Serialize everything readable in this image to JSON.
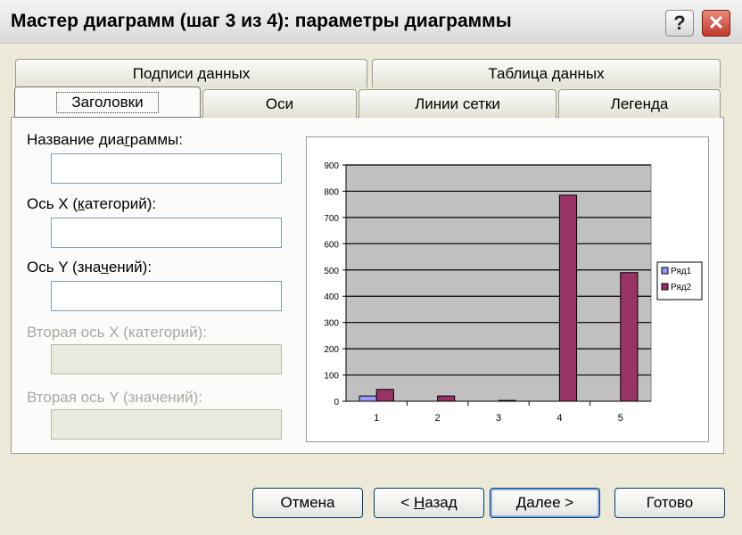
{
  "window": {
    "title": "Мастер диаграмм (шаг 3 из 4): параметры диаграммы",
    "help_label": "?",
    "close_label": "✕"
  },
  "tabs_back": [
    "Подписи данных",
    "Таблица данных"
  ],
  "tabs_front": [
    "Заголовки",
    "Оси",
    "Линии сетки",
    "Легенда"
  ],
  "active_tab": "Заголовки",
  "fields": {
    "chart_title": {
      "pre": "Название диа",
      "acc": "г",
      "post": "раммы:",
      "value": "",
      "enabled": true
    },
    "x_axis": {
      "pre": "Ось X (",
      "acc": "к",
      "post": "атегорий):",
      "value": "",
      "enabled": true
    },
    "y_axis": {
      "pre": "Ось Y (зна",
      "acc": "ч",
      "post": "ений):",
      "value": "",
      "enabled": true
    },
    "x2_axis": {
      "label": "Вторая ось X (категорий):",
      "value": "",
      "enabled": false
    },
    "y2_axis": {
      "label": "Вторая ось Y (значений):",
      "value": "",
      "enabled": false
    }
  },
  "chart_data": {
    "type": "bar",
    "categories": [
      "1",
      "2",
      "3",
      "4",
      "5"
    ],
    "series": [
      {
        "name": "Ряд1",
        "color": "#9999FF",
        "values": [
          20,
          0,
          0,
          0,
          0
        ]
      },
      {
        "name": "Ряд2",
        "color": "#993366",
        "values": [
          45,
          20,
          3,
          785,
          490
        ]
      }
    ],
    "ylim": [
      0,
      900
    ],
    "yticks": [
      "0",
      "100",
      "200",
      "300",
      "400",
      "500",
      "600",
      "700",
      "800",
      "900"
    ],
    "plot_background": "#C0C0C0",
    "grid": true,
    "legend_position": "right"
  },
  "buttons": {
    "cancel": "Отмена",
    "back": {
      "pre": "< ",
      "acc": "Н",
      "post": "азад"
    },
    "next": {
      "pre": "",
      "acc": "Д",
      "post": "алее >"
    },
    "finish": "Готово"
  }
}
